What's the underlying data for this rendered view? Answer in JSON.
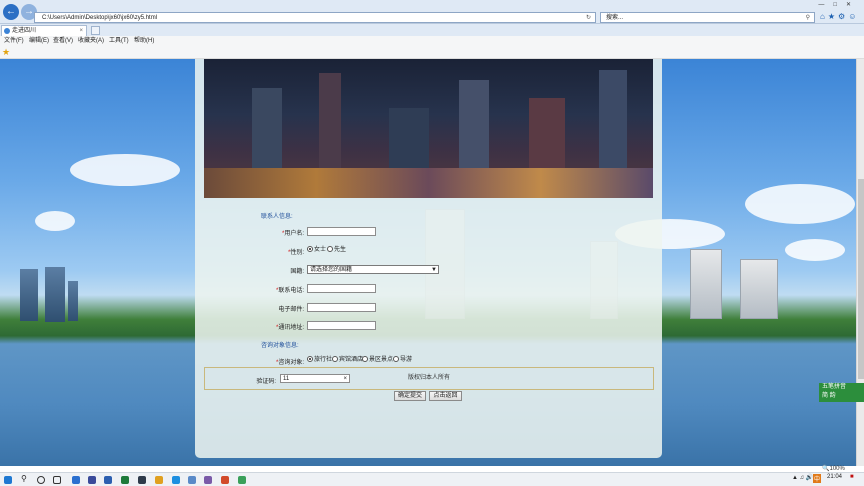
{
  "browser": {
    "url": "C:\\Users\\Admin\\Desktop\\jx60\\jx60\\zy5.html",
    "search_placeholder": "搜索...",
    "tab_title": "走进四川",
    "zoom": "100%"
  },
  "menu": [
    "文件(F)",
    "编辑(E)",
    "查看(V)",
    "收藏夹(A)",
    "工具(T)",
    "帮助(H)"
  ],
  "form": {
    "section_contact": "联系人信息:",
    "username_label": "用户名:",
    "username_value": "",
    "gender_label": "性别:",
    "gender_female": "女士",
    "gender_male": "先生",
    "country_label": "国籍:",
    "country_selected": "请选择您的国籍",
    "phone_label": "联系电话:",
    "email_label": "电子邮件:",
    "address_label": "通讯地址:",
    "section_consult": "咨询对象信息:",
    "consult_label": "咨询对象:",
    "consult_options": [
      "旅行社",
      "宾馆酒店",
      "景区景点",
      "导游"
    ],
    "captcha_label": "验证码:",
    "captcha_value": "11",
    "submit_label": "确定提交",
    "back_label": "点击返回",
    "footer": "版权归本人所有",
    "required_mark": "*"
  },
  "ime": {
    "line1": "五笔拼音",
    "line2": "简 韵"
  },
  "taskbar": {
    "time": "21:04",
    "lang": "中"
  }
}
